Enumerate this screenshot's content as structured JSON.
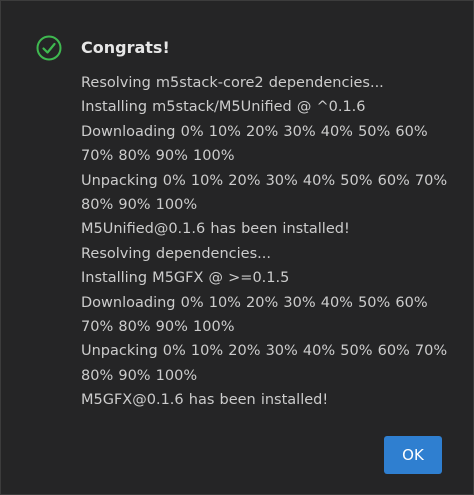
{
  "dialog": {
    "title": "Congrats!",
    "status_icon": "check-circle-icon",
    "accent_color": "#3fb950",
    "log_lines": [
      "Resolving m5stack-core2 dependencies...",
      "Installing m5stack/M5Unified @ ^0.1.6",
      "Downloading 0% 10% 20% 30% 40% 50% 60% 70% 80% 90% 100%",
      "Unpacking 0% 10% 20% 30% 40% 50% 60% 70% 80% 90% 100%",
      "M5Unified@0.1.6 has been installed!",
      "Resolving dependencies...",
      "Installing M5GFX @ >=0.1.5",
      "Downloading 0% 10% 20% 30% 40% 50% 60% 70% 80% 90% 100%",
      "Unpacking 0% 10% 20% 30% 40% 50% 60% 70% 80% 90% 100%",
      "M5GFX@0.1.6 has been installed!"
    ],
    "ok_label": "OK",
    "button_color": "#2f7fd0"
  }
}
